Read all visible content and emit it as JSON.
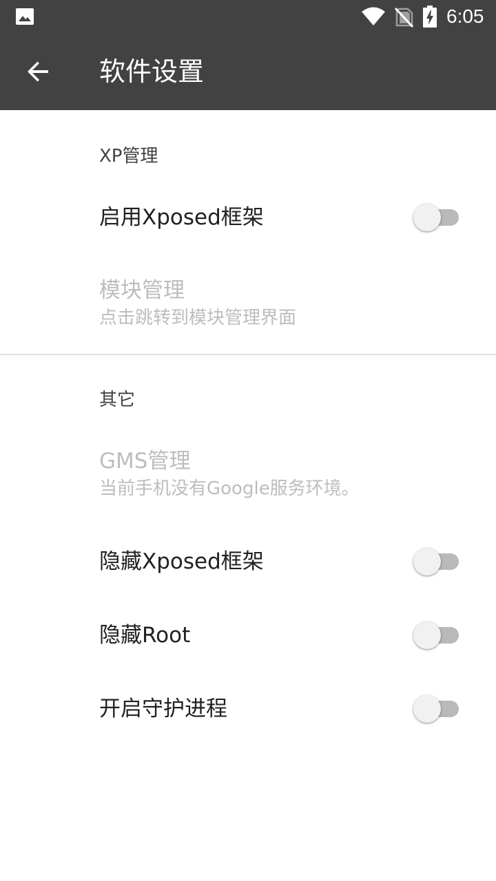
{
  "status_bar": {
    "time": "6:05",
    "icons": [
      "gallery-icon",
      "wifi-icon",
      "no-sim-icon",
      "battery-charging-icon"
    ]
  },
  "app_bar": {
    "back_icon": "arrow-back-icon",
    "title": "软件设置"
  },
  "sections": {
    "xp": {
      "header": "XP管理",
      "enable_xposed": {
        "title": "启用Xposed框架",
        "checked": false
      },
      "module_manage": {
        "title": "模块管理",
        "summary": "点击跳转到模块管理界面"
      }
    },
    "other": {
      "header": "其它",
      "gms": {
        "title": "GMS管理",
        "summary": "当前手机没有Google服务环境。"
      },
      "hide_xposed": {
        "title": "隐藏Xposed框架",
        "checked": false
      },
      "hide_root": {
        "title": "隐藏Root",
        "checked": false
      },
      "daemon": {
        "title": "开启守护进程",
        "checked": false
      }
    }
  },
  "colors": {
    "app_bar": "#424242",
    "switch_track_off": "#b9b9b9",
    "switch_thumb_off": "#f1f1f1",
    "disabled_text": "#bdbdbd"
  }
}
